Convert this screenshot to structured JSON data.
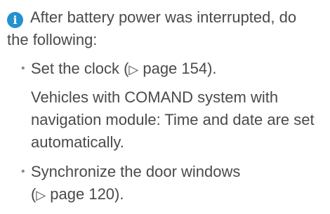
{
  "note": {
    "icon": "info-icon",
    "accent_color": "#2492cf",
    "intro_line1": "After battery power was interrupted, do",
    "intro_line2": "the following:",
    "items": [
      {
        "bullet": "•",
        "text_before": "Set the clock (",
        "ref_arrow": "▷",
        "text_after": " page 154).",
        "sub_line1": "Vehicles with COMAND system with",
        "sub_line2": "navigation module: Time and date are set",
        "sub_line3": "automatically."
      },
      {
        "bullet": "•",
        "line1": "Synchronize the door windows",
        "line2_open": "(",
        "ref_arrow": "▷",
        "line2_rest": " page 120)."
      }
    ]
  }
}
